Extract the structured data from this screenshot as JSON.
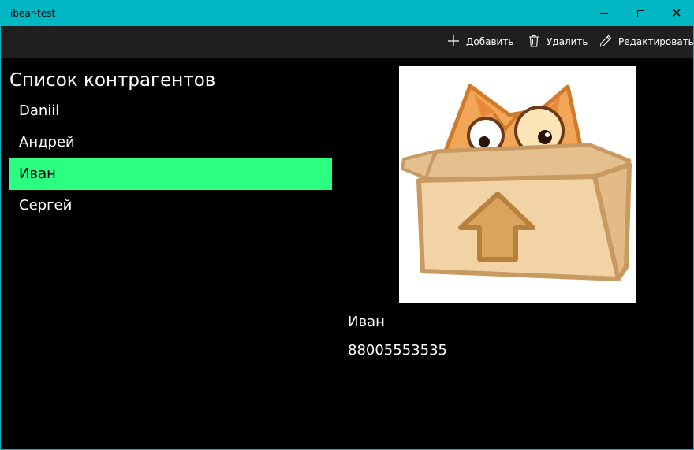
{
  "window": {
    "title": "ibear-test",
    "accent_color": "#00b7c3"
  },
  "toolbar": {
    "add_label": "Добавить",
    "add_icon": "plus-icon",
    "delete_label": "Удалить",
    "delete_icon": "trash-icon",
    "edit_label": "Редактировать",
    "edit_icon": "pencil-icon"
  },
  "list": {
    "heading": "Список контрагентов",
    "items": [
      {
        "label": "Daniil"
      },
      {
        "label": "Андрей"
      },
      {
        "label": "Иван"
      },
      {
        "label": "Сергей"
      }
    ],
    "selected_color": "#2bff80"
  },
  "detail": {
    "name": "Иван",
    "phone": "88005553535",
    "image": "cat-in-box-illustration"
  }
}
